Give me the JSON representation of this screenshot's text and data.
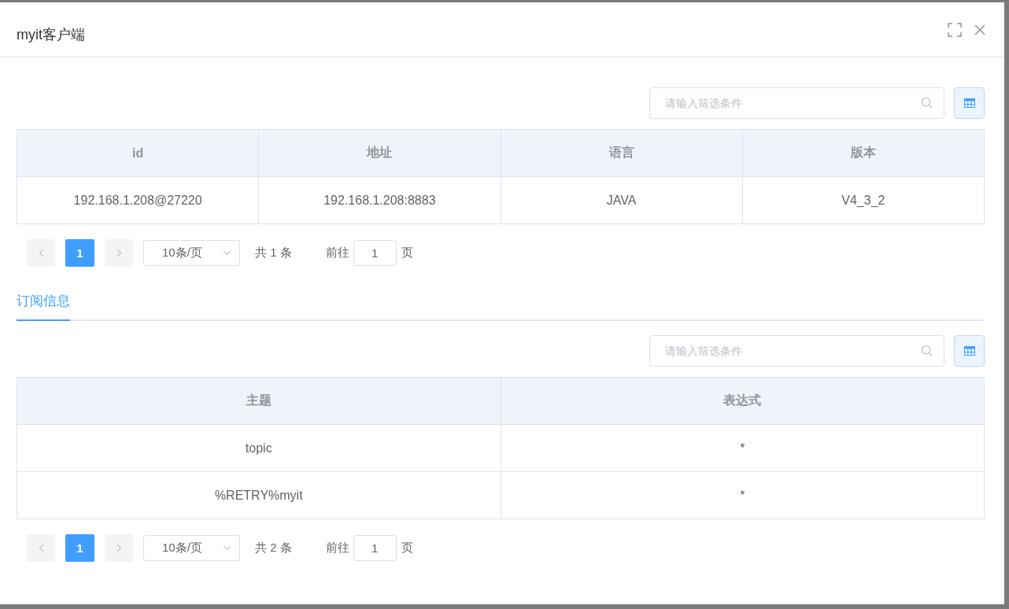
{
  "dialog": {
    "title": "myit客户端"
  },
  "panels": [
    {
      "search": {
        "placeholder": "请输入筛选条件"
      },
      "table": {
        "columns": [
          "id",
          "地址",
          "语言",
          "版本"
        ],
        "rows": [
          [
            "192.168.1.208@27220",
            "192.168.1.208:8883",
            "JAVA",
            "V4_3_2"
          ]
        ]
      },
      "pagination": {
        "prev_disabled": true,
        "next_disabled": true,
        "pages": [
          {
            "label": "1",
            "selected": true
          }
        ],
        "page_size": "10条/页",
        "total": "共 1 条",
        "goto_label": "前往",
        "goto_value": "1",
        "goto_suffix": "页"
      }
    },
    {
      "search": {
        "placeholder": "请输入筛选条件"
      },
      "table": {
        "columns": [
          "主题",
          "表达式"
        ],
        "rows": [
          [
            "topic",
            "*"
          ],
          [
            "%RETRY%myit",
            "*"
          ]
        ]
      },
      "pagination": {
        "prev_disabled": true,
        "next_disabled": true,
        "pages": [
          {
            "label": "1",
            "selected": true
          }
        ],
        "page_size": "10条/页",
        "total": "共 2 条",
        "goto_label": "前往",
        "goto_value": "1",
        "goto_suffix": "页"
      }
    }
  ],
  "tabs": [
    {
      "label": "订阅信息",
      "selected": true
    }
  ]
}
